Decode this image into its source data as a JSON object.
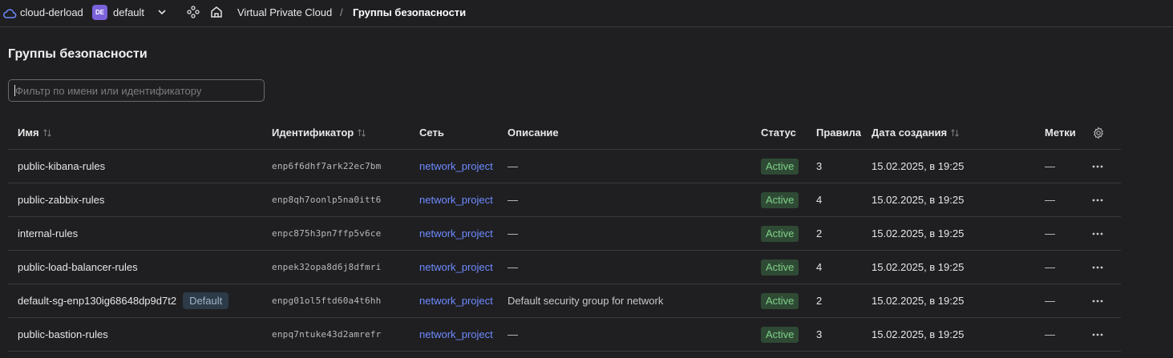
{
  "topbar": {
    "cloud_name": "cloud-derload",
    "folder_badge": "DE",
    "folder_name": "default",
    "breadcrumb_service": "Virtual Private Cloud",
    "breadcrumb_sep": "/",
    "breadcrumb_page": "Группы безопасности"
  },
  "page": {
    "title": "Группы безопасности",
    "filter_placeholder": "Фильтр по имени или идентификатору",
    "filter_value": ""
  },
  "table": {
    "headers": {
      "name": "Имя",
      "id": "Идентификатор",
      "network": "Сеть",
      "description": "Описание",
      "status": "Статус",
      "rules": "Правила",
      "created": "Дата создания",
      "labels": "Метки"
    },
    "rows": [
      {
        "name": "public-kibana-rules",
        "badge": "",
        "id": "enp6f6dhf7ark22ec7bm",
        "network": "network_project",
        "description": "—",
        "status": "Active",
        "rules": "3",
        "created": "15.02.2025, в 19:25",
        "labels": "—"
      },
      {
        "name": "public-zabbix-rules",
        "badge": "",
        "id": "enp8qh7oonlp5na0itt6",
        "network": "network_project",
        "description": "—",
        "status": "Active",
        "rules": "4",
        "created": "15.02.2025, в 19:25",
        "labels": "—"
      },
      {
        "name": "internal-rules",
        "badge": "",
        "id": "enpc875h3pn7ffp5v6ce",
        "network": "network_project",
        "description": "—",
        "status": "Active",
        "rules": "2",
        "created": "15.02.2025, в 19:25",
        "labels": "—"
      },
      {
        "name": "public-load-balancer-rules",
        "badge": "",
        "id": "enpek32opa8d6j8dfmri",
        "network": "network_project",
        "description": "—",
        "status": "Active",
        "rules": "4",
        "created": "15.02.2025, в 19:25",
        "labels": "—"
      },
      {
        "name": "default-sg-enp130ig68648dp9d7t2",
        "badge": "Default",
        "id": "enpg01ol5ftd60a4t6hh",
        "network": "network_project",
        "description": "Default security group for network",
        "status": "Active",
        "rules": "2",
        "created": "15.02.2025, в 19:25",
        "labels": "—"
      },
      {
        "name": "public-bastion-rules",
        "badge": "",
        "id": "enpq7ntuke43d2amrefr",
        "network": "network_project",
        "description": "—",
        "status": "Active",
        "rules": "3",
        "created": "15.02.2025, в 19:25",
        "labels": "—"
      }
    ]
  },
  "colors": {
    "background": "#1f1f22",
    "link": "#6e8bff",
    "status_active_bg": "#2f4a34",
    "status_active_text": "#7fd08a",
    "folder_badge_bg": "#7b61d9"
  },
  "icons": [
    "cloud-icon",
    "chevron-down-icon",
    "services-icon",
    "home-icon",
    "sort-icon",
    "gear-icon",
    "more-dots-icon"
  ]
}
